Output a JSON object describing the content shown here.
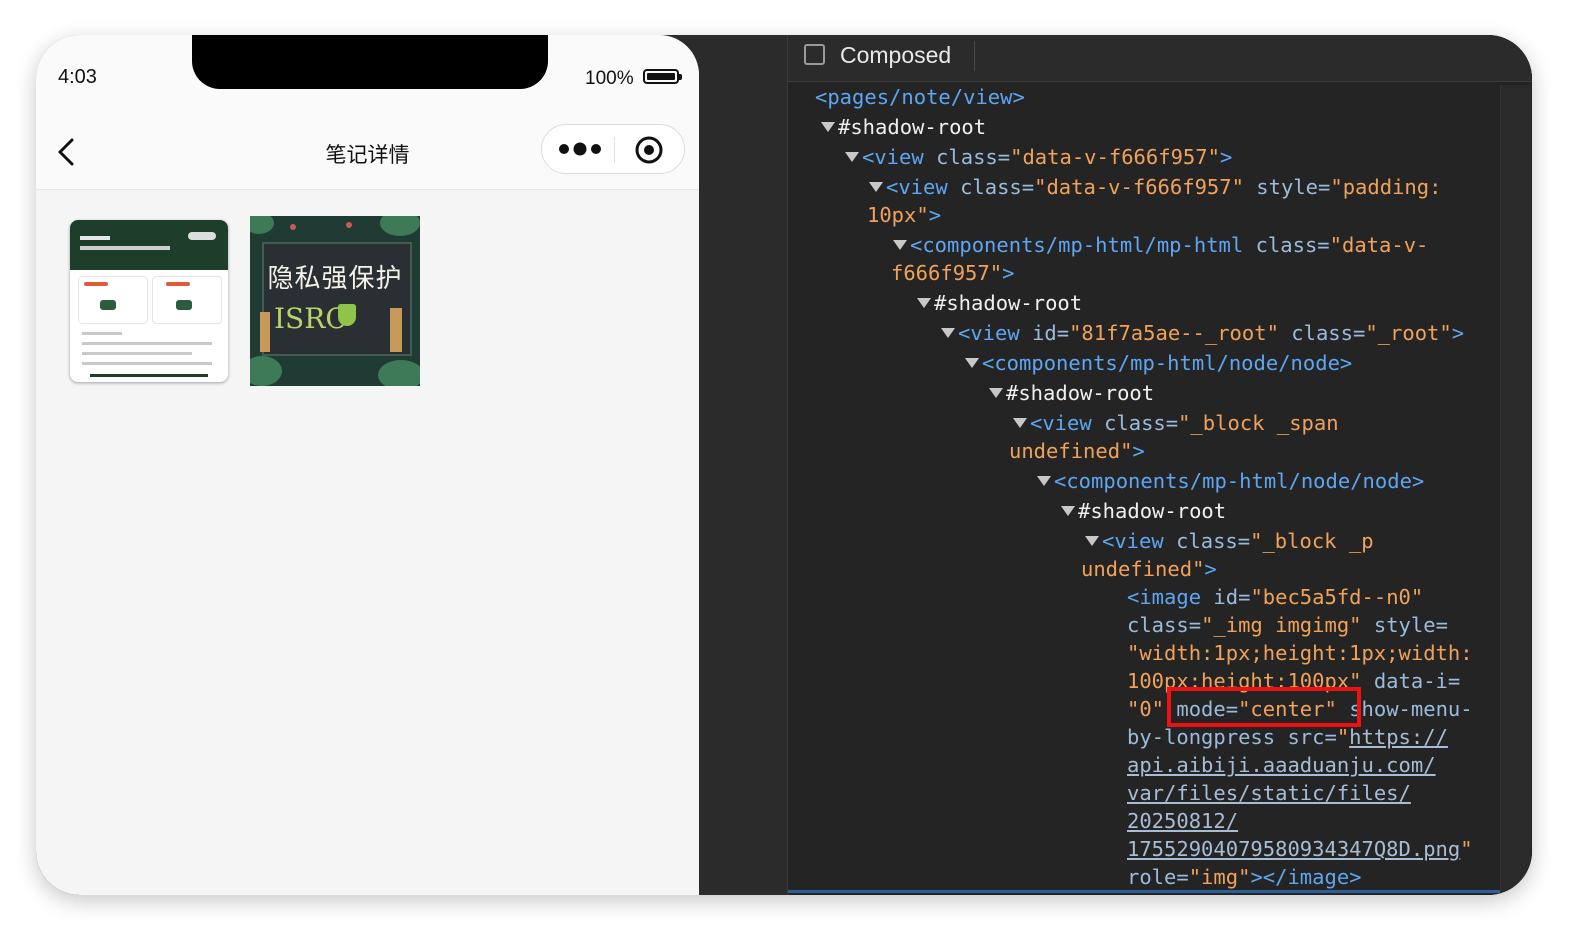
{
  "phone": {
    "status": {
      "time": "4:03",
      "battery": "100%"
    },
    "nav": {
      "title": "笔记详情"
    },
    "images": [
      {
        "name": "app-screenshot-thumbnail"
      },
      {
        "name": "privacy-protection-thumbnail",
        "title_text": "隐私强保护",
        "logo_text": "ISRC"
      }
    ]
  },
  "devtools": {
    "toolbar": {
      "composed_label": "Composed",
      "composed_checked": false
    },
    "tree": {
      "l1_tag": "<pages/note/view>",
      "l2_text": "#shadow-root",
      "l3_tag": "<view",
      "l3_attr": "class=",
      "l3_val": "\"data-v-f666f957\"",
      "l3_end": ">",
      "l4_tag": "<view",
      "l4_attr1": "class=",
      "l4_val1": "\"data-v-f666f957\"",
      "l4_attr2": "style=",
      "l4_val2a": "\"padding:",
      "l4_val2b": "10px\"",
      "l4_end": ">",
      "l5_tag": "<components/mp-html/mp-html",
      "l5_attr": "class=",
      "l5_val_a": "\"data-v-",
      "l5_val_b": "f666f957\"",
      "l5_end": ">",
      "l6_text": "#shadow-root",
      "l7_tag": "<view",
      "l7_attr1": "id=",
      "l7_val1": "\"81f7a5ae--_root\"",
      "l7_attr2": "class=",
      "l7_val2": "\"_root\"",
      "l7_end": ">",
      "l8_tag": "<components/mp-html/node/node>",
      "l9_text": "#shadow-root",
      "l10_tag": "<view",
      "l10_attr": "class=",
      "l10_val_a": "\"_block _span",
      "l10_val_b": "undefined\"",
      "l10_end": ">",
      "l11_tag": "<components/mp-html/node/node>",
      "l12_text": "#shadow-root",
      "l13_tag": "<view",
      "l13_attr": "class=",
      "l13_val_a": "\"_block _p",
      "l13_val_b": "undefined\"",
      "l13_end": ">",
      "img_tag": "<image",
      "img_attr_id": "id=",
      "img_val_id": "\"bec5a5fd--n0\"",
      "img_attr_class": "class=",
      "img_val_class": "\"_img imgimg\"",
      "img_attr_style": "style=",
      "img_val_style_a": "\"width:1px;height:1px;width:",
      "img_val_style_b": "100px;height:100px\"",
      "img_attr_datai": "data-i=",
      "img_val_datai": "\"0\"",
      "img_attr_mode": "mode=",
      "img_val_mode": "\"center\"",
      "img_attr_show": "show-menu-",
      "img_attr_show_b": "by-longpress",
      "img_attr_src": "src=",
      "img_val_src_q": "\"",
      "img_url_1": "https://",
      "img_url_2": "api.aibiji.aaaduanju.com/",
      "img_url_3": "var/files/static/files/",
      "img_url_4": "20250812/",
      "img_url_5": "17552904079580934347Q8D.png",
      "img_url_end": "\"",
      "img_attr_role": "role=",
      "img_val_role": "\"img\"",
      "img_close": "></image>"
    },
    "highlight_color": "#ee1111"
  },
  "colors": {
    "tag": "#5ea6f2",
    "attr_name": "#9bbbdc",
    "attr_value": "#f1a25a",
    "devtools_bg": "#242424"
  }
}
